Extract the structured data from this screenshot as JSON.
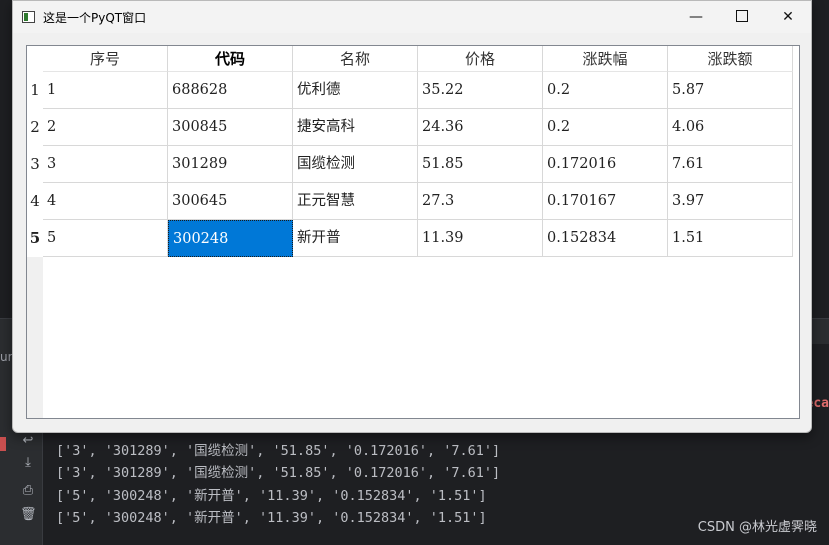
{
  "window": {
    "title": "这是一个PyQT窗口",
    "controls": {
      "minimize": "—",
      "close": "✕"
    }
  },
  "table": {
    "headers": [
      "序号",
      "代码",
      "名称",
      "价格",
      "涨跌幅",
      "涨跌额"
    ],
    "row_numbers": [
      "1",
      "2",
      "3",
      "4",
      "5"
    ],
    "rows": [
      [
        "1",
        "688628",
        "优利德",
        "35.22",
        "0.2",
        "5.87"
      ],
      [
        "2",
        "300845",
        "捷安高科",
        "24.36",
        "0.2",
        "4.06"
      ],
      [
        "3",
        "301289",
        "国缆检测",
        "51.85",
        "0.172016",
        "7.61"
      ],
      [
        "4",
        "300645",
        "正元智慧",
        "27.3",
        "0.170167",
        "3.97"
      ],
      [
        "5",
        "300248",
        "新开普",
        "11.39",
        "0.152834",
        "1.51"
      ]
    ],
    "selected_cell": {
      "row": 5,
      "column": "代码"
    }
  },
  "ide": {
    "run_label": "ur",
    "console_lines": [
      "['3', '301289', '国缆检测', '51.85', '0.172016', '7.61']",
      "['3', '301289', '国缆检测', '51.85', '0.172016', '7.61']",
      "['5', '300248', '新开普', '11.39', '0.152834', '1.51']",
      "['5', '300248', '新开普', '11.39', '0.152834', '1.51']"
    ],
    "console_fragment": "eca"
  },
  "watermark": "CSDN @林光虚霁晓",
  "colors": {
    "selection": "#0078d7",
    "ide_bg": "#1e1f22"
  },
  "icons": [
    "app-icon",
    "minimize-icon",
    "maximize-icon",
    "close-icon",
    "rerun-icon",
    "scroll-end-icon",
    "print-icon",
    "trash-icon"
  ]
}
